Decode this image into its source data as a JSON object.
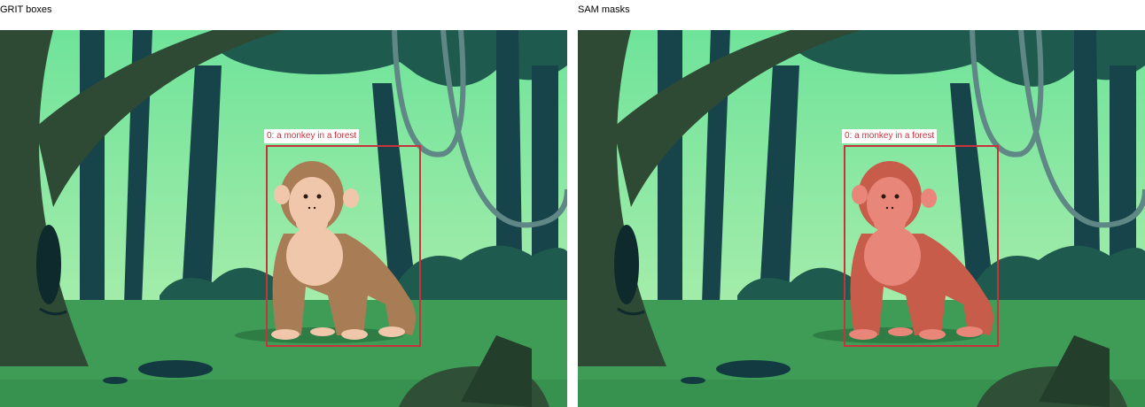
{
  "left_panel": {
    "title": "GRIT boxes",
    "detections": [
      {
        "label": "0: a monkey in a forest"
      }
    ]
  },
  "right_panel": {
    "title": "SAM masks",
    "detections": [
      {
        "label": "0: a monkey in a forest"
      }
    ]
  },
  "colors": {
    "box": "#c8323c",
    "mask": "#d9584a",
    "sky": "#8fe0a5",
    "ground": "#3e9c57"
  }
}
